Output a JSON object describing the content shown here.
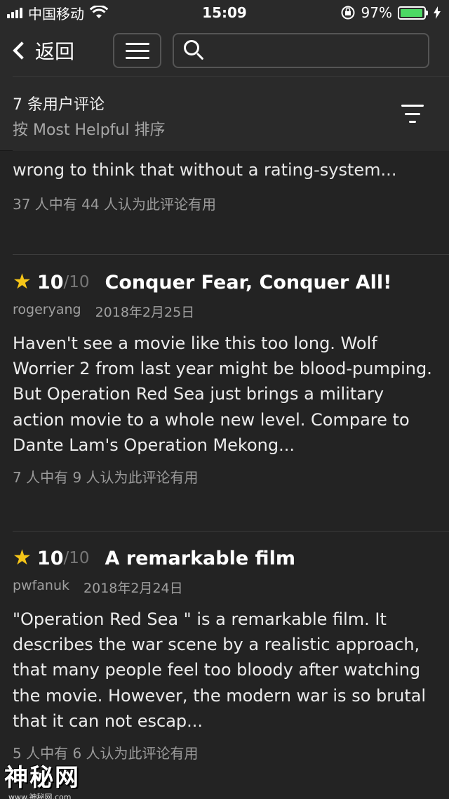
{
  "status_bar": {
    "carrier": "中国移动",
    "time": "15:09",
    "battery_percent": "97%",
    "battery_level": 0.97
  },
  "nav": {
    "back_label": "返回",
    "search_placeholder": ""
  },
  "sort_header": {
    "review_count": "7 条用户评论",
    "sort_by": "按 Most Helpful 排序"
  },
  "partial_review": {
    "text": "wrong to think that without a rating-system...",
    "helpful": "37 人中有 44 人认为此评论有用"
  },
  "reviews": [
    {
      "rating": "10",
      "rating_max": "/10",
      "title": "Conquer Fear, Conquer All!",
      "author": "rogeryang",
      "date": "2018年2月25日",
      "body": "Haven't see a movie like this too long. Wolf Worrier 2 from last year might be blood-pumping. But Operation Red Sea just brings a military action movie to a whole new level. Compare to Dante Lam's Operation Mekong...",
      "helpful": "7 人中有 9 人认为此评论有用"
    },
    {
      "rating": "10",
      "rating_max": "/10",
      "title": "A remarkable film",
      "author": "pwfanuk",
      "date": "2018年2月24日",
      "body": "\"Operation Red Sea \" is a remarkable film. It describes the war scene by a realistic approach, that many people feel too bloody after watching the movie. However, the modern war is so brutal that it can not escap...",
      "helpful": "5 人中有 6 人认为此评论有用"
    }
  ],
  "watermark": {
    "main": "神秘网",
    "sub": "www.神秘网.com"
  },
  "colors": {
    "background": "#232323",
    "star": "#f5c518",
    "battery": "#4cd964"
  }
}
